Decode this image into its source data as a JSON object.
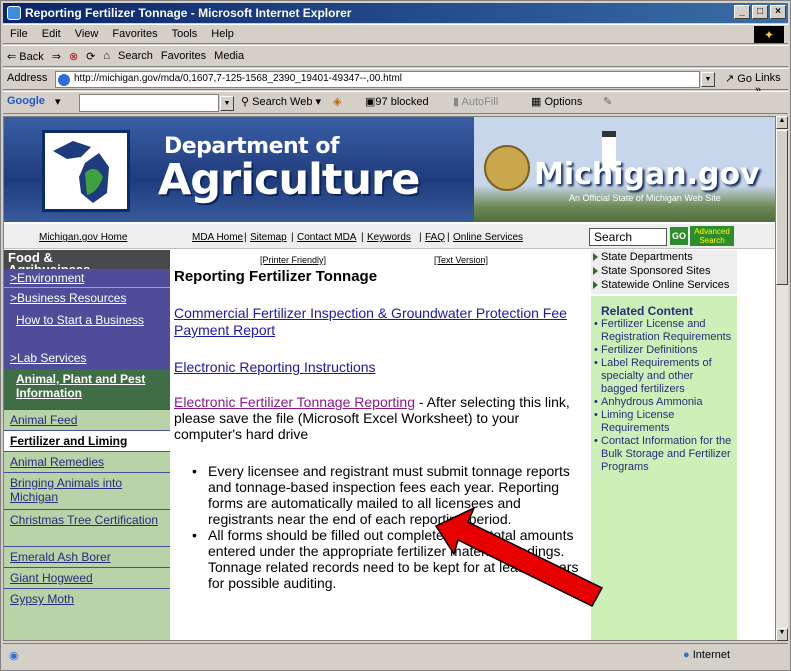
{
  "window": {
    "title": "Reporting Fertilizer Tonnage - Microsoft Internet Explorer"
  },
  "menu": [
    "File",
    "Edit",
    "View",
    "Favorites",
    "Tools",
    "Help"
  ],
  "toolbar": [
    "⇐ Back",
    "⇒",
    "⊗",
    "⟳",
    "⌂",
    "Search",
    "Favorites",
    "Media"
  ],
  "address": {
    "label": "Address",
    "url": "http://michigan.gov/mda/0,1607,7-125-1568_2390_19401-49347--,00.html",
    "go": "Go",
    "links": "Links"
  },
  "google": {
    "label": "Google",
    "search_web": "Search Web",
    "blocked": "97 blocked",
    "autofill": "AutoFill",
    "options": "Options"
  },
  "banner": {
    "dept": "Department of",
    "agri": "Agriculture",
    "michigan": "Michigan.gov",
    "tag": "An Official State of Michigan Web Site"
  },
  "nav": {
    "home": "Michigan.gov Home",
    "links": [
      "MDA Home",
      "Sitemap",
      "Contact MDA",
      "Keywords",
      "FAQ",
      "Online Services"
    ],
    "search_value": "Search",
    "go": "GO",
    "advanced": "Advanced Search"
  },
  "sidebar": {
    "head1": "Food &",
    "head2": "Agribusiness",
    "items": [
      "Environment",
      "Business Resources",
      "How to Start a Business",
      "Lab Services",
      "Animal, Plant and Pest Information",
      "Animal Feed",
      "Fertilizer and Liming",
      "Animal Remedies",
      "Bringing Animals into Michigan",
      "Christmas Tree Certification",
      "Emerald Ash Borer",
      "Giant Hogweed",
      "Gypsy Moth"
    ]
  },
  "main": {
    "printer": "[Printer Friendly]",
    "textver": "[Text Version]",
    "title": "Reporting Fertilizer Tonnage",
    "link1": "Commercial Fertilizer Inspection & Groundwater Protection Fee Payment Report",
    "link2": "Electronic Reporting Instructions",
    "link3": "Electronic Fertilizer Tonnage Reporting",
    "para3": " - After selecting this link, please save the file (Microsoft Excel Worksheet) to your computer's hard drive",
    "bullets": [
      "Every licensee and registrant must submit tonnage reports and tonnage-based inspection fees each year. Reporting forms are automatically mailed to all licensees and registrants near the end of each reporting period.",
      "All forms should be filled out completely, with total amounts entered under the appropriate fertilizer material headings. Tonnage related records need to be kept for at least 3 years for possible auditing."
    ]
  },
  "right": {
    "top": [
      "State Departments",
      "State Sponsored Sites",
      "Statewide Online Services"
    ],
    "related_title": "Related Content",
    "related": [
      "Fertilizer License and Registration Requirements",
      "Fertilizer Definitions",
      "Label Requirements of specialty and other bagged fertilizers",
      "Anhydrous Ammonia",
      "Liming License Requirements",
      "Contact Information for the Bulk Storage and Fertilizer Programs"
    ]
  },
  "status": {
    "zone": "Internet"
  },
  "colors": {
    "sidebar": "#4d4d99",
    "sidebar_green": "#3f6d45",
    "right_green": "#cdf0b8",
    "arrow": "#e60000"
  }
}
